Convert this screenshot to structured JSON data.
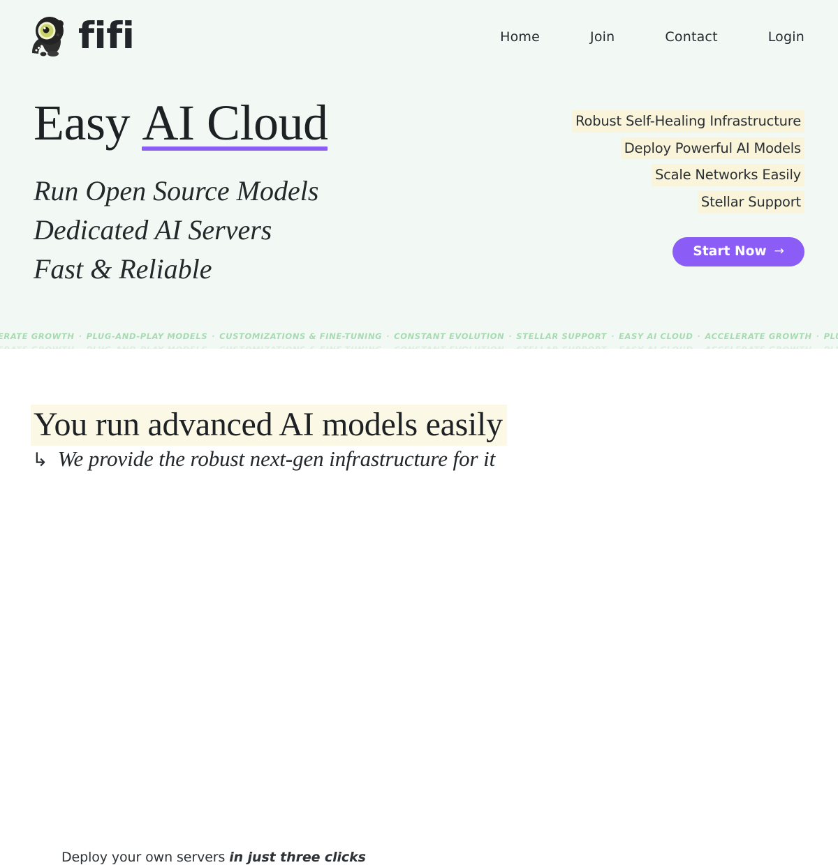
{
  "colors": {
    "hero_background": "#f2f9f4",
    "page_background": "#ffffff",
    "accent_purple": "#8b5cf6",
    "highlight_cream": "#faf5da",
    "heading_highlight": "#fbf8e6",
    "marquee_green": "#a8dbb2",
    "text_dark": "#1d2124"
  },
  "header": {
    "brand": {
      "logo_icon": "dino-mascot-icon",
      "name": "fifi"
    },
    "nav": [
      {
        "label": "Home"
      },
      {
        "label": "Join"
      },
      {
        "label": "Contact"
      },
      {
        "label": "Login"
      }
    ]
  },
  "hero": {
    "title_plain": "Easy ",
    "title_underlined": "AI Cloud",
    "sublines": [
      "Run Open Source Models",
      "Dedicated AI Servers",
      "Fast & Reliable"
    ],
    "features": [
      "Robust Self-Healing Infrastructure",
      "Deploy Powerful AI Models",
      "Scale Networks Easily",
      "Stellar Support"
    ],
    "cta": {
      "label": "Start Now",
      "arrow": "→"
    }
  },
  "marquee": {
    "items": [
      "EASY AI CLOUD",
      "ACCELERATE GROWTH",
      "PLUG-AND-PLAY MODELS",
      "CUSTOMIZATIONS & FINE-TUNING",
      "CONSTANT EVOLUTION",
      "STELLAR SUPPORT"
    ],
    "separator": "·"
  },
  "section_two": {
    "heading": "You run advanced AI models easily",
    "sub_arrow": "↳",
    "subheading": "We provide the robust next-gen infrastructure for it",
    "deploy_plain": "Deploy your own servers ",
    "deploy_emph": "in just three clicks"
  }
}
